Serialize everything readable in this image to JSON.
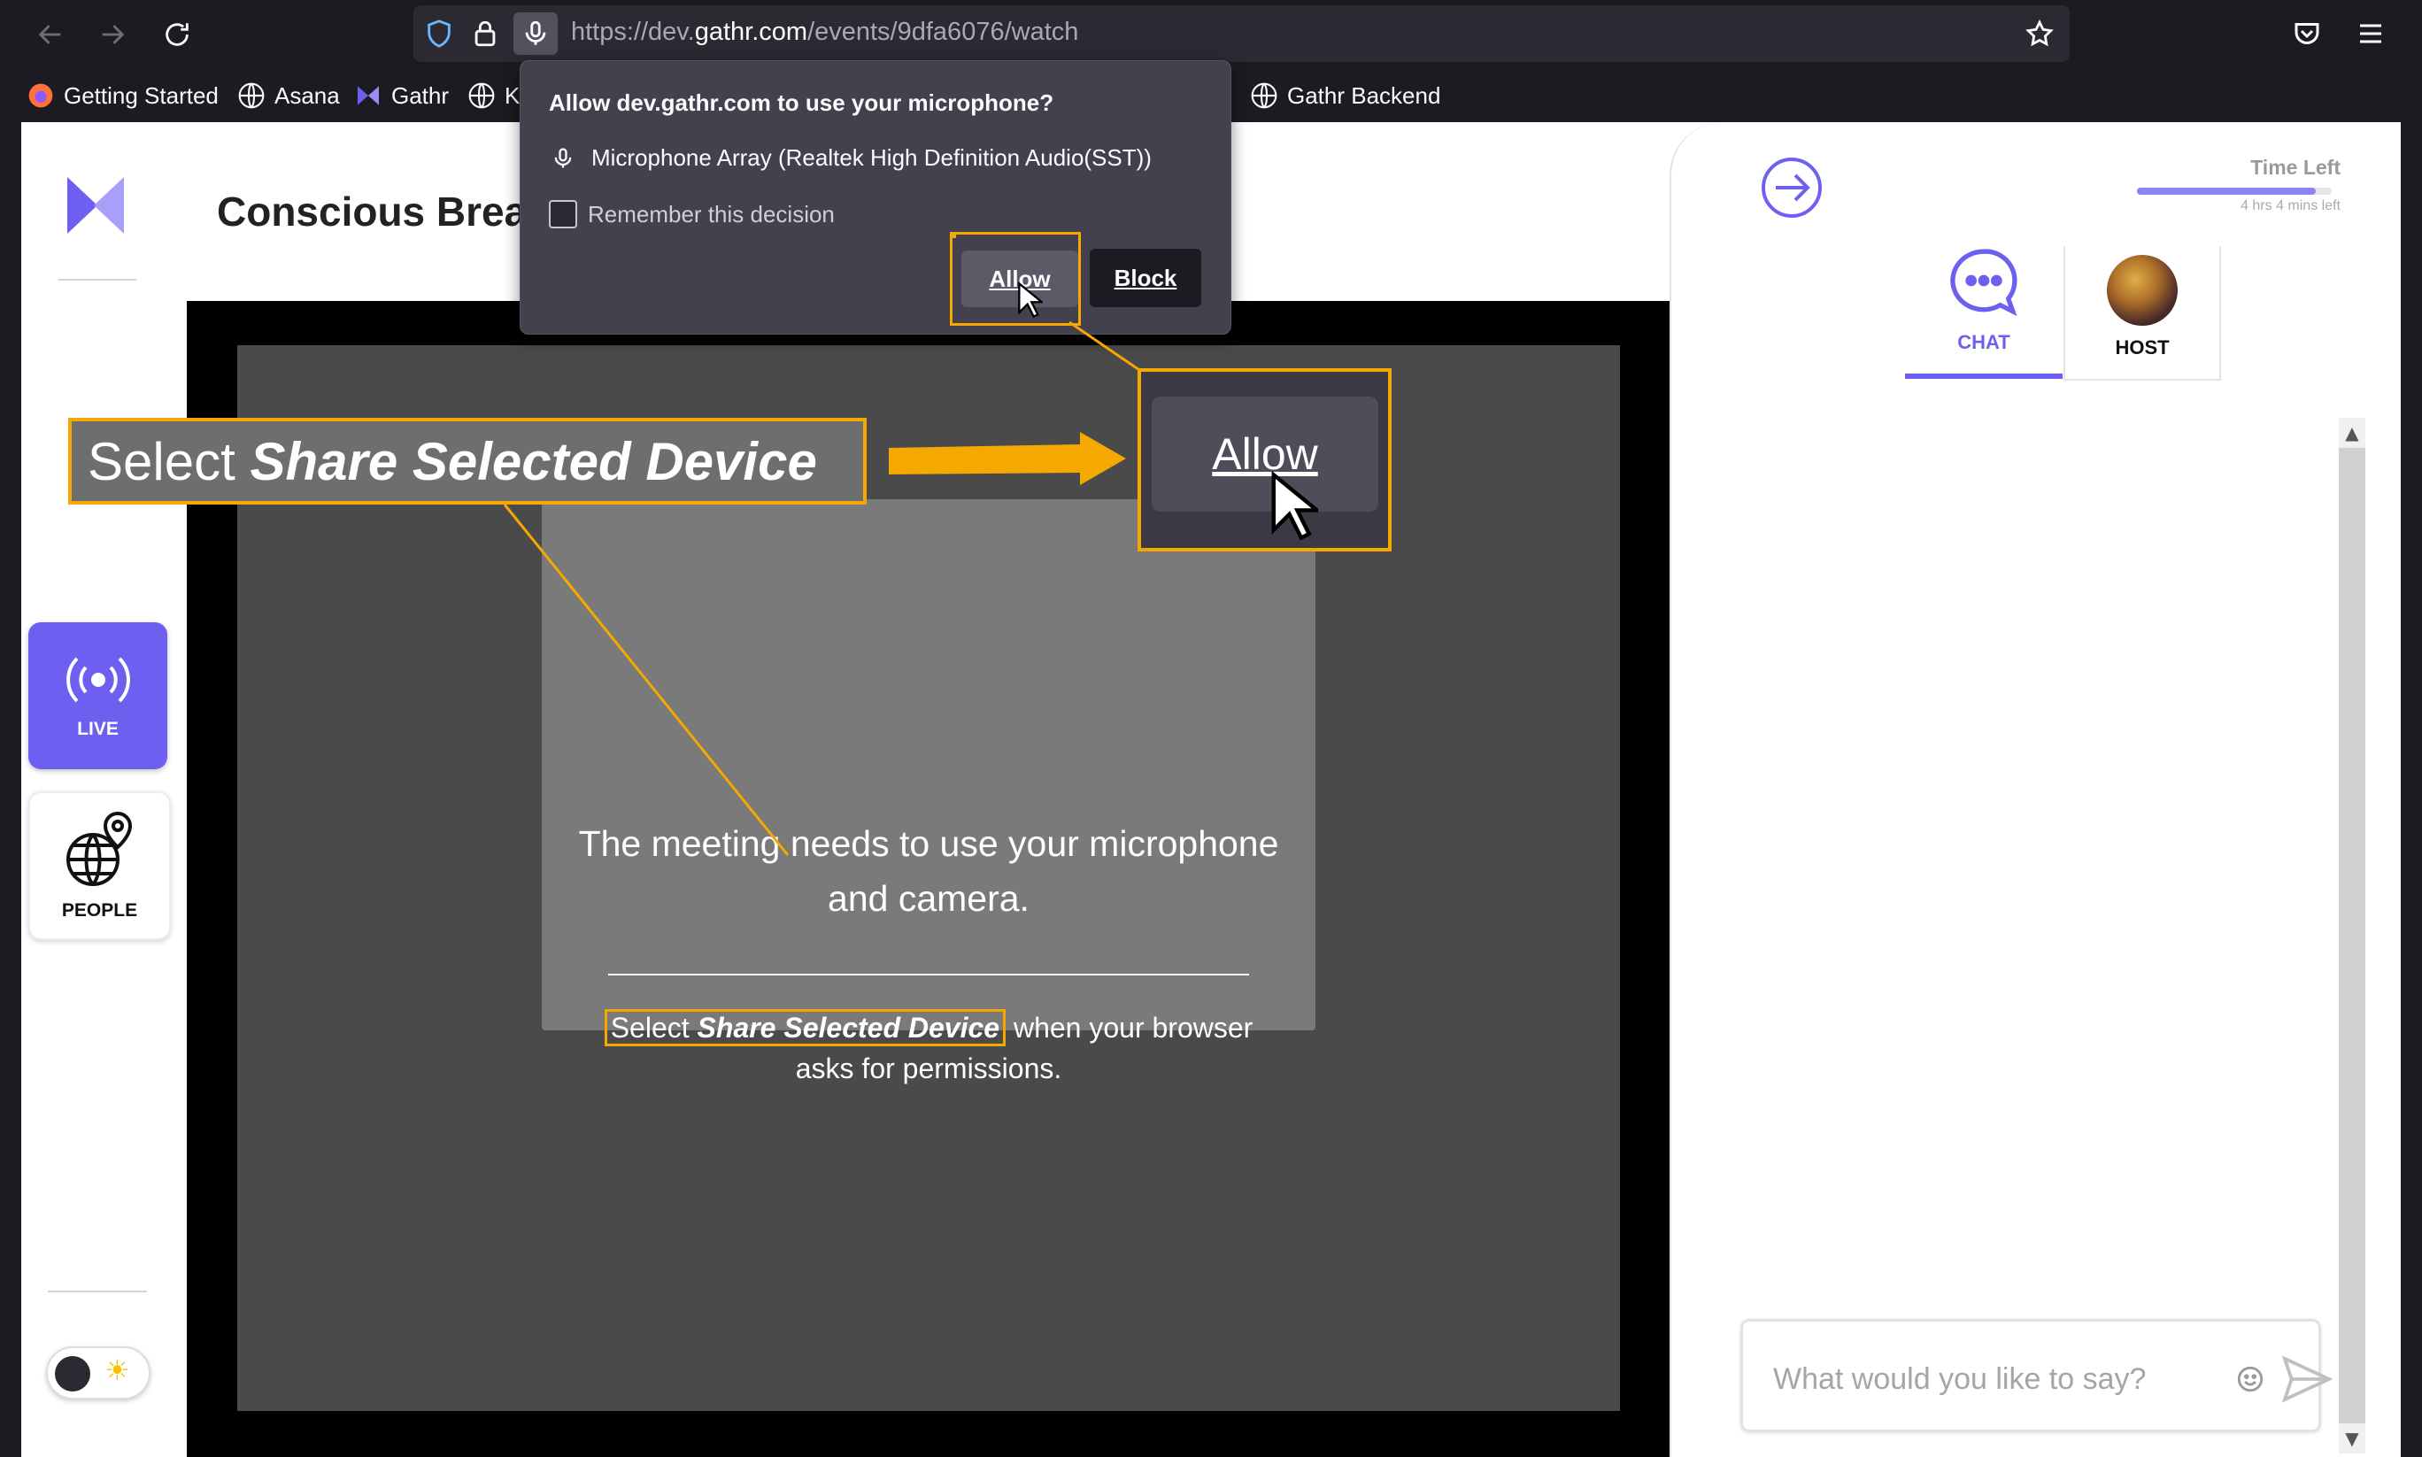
{
  "browser": {
    "url_prefix": "https://dev.",
    "url_domain": "gathr.com",
    "url_path": "/events/9dfa6076/watch",
    "icons": [
      "back-arrow-icon",
      "forward-arrow-icon",
      "reload-icon",
      "shield-icon",
      "lock-icon",
      "microphone-icon",
      "bookmark-star-icon",
      "pocket-icon",
      "menu-icon"
    ]
  },
  "bookmarks": [
    {
      "label": "Getting Started",
      "icon": "firefox-icon"
    },
    {
      "label": "Asana",
      "icon": "globe-icon"
    },
    {
      "label": "Gathr",
      "icon": "gathr-icon"
    },
    {
      "label": "Ki",
      "icon": "globe-icon"
    },
    {
      "label": "Gathr Backend",
      "icon": "globe-icon"
    }
  ],
  "popup": {
    "title": "Allow dev.gathr.com to use your microphone?",
    "device": "Microphone Array (Realtek High Definition Audio(SST))",
    "remember": "Remember this decision",
    "allow": "Allow",
    "block": "Block"
  },
  "app": {
    "title": "Conscious Brea",
    "live_label": "LIVE",
    "people_label": "PEOPLE"
  },
  "stage": {
    "heading": "The meeting needs to use your microphone and camera.",
    "instr_select": "Select",
    "instr_bold": "Share Selected Device",
    "instr_rest": "when your browser asks for permissions."
  },
  "panel": {
    "time_left": "Time Left",
    "time_left_sub": "4 hrs 4 mins left",
    "time_fraction": 0.92,
    "tab_chat": "CHAT",
    "tab_host": "HOST",
    "input_placeholder": "What would you like to say?"
  },
  "callout": {
    "select": "Select",
    "bold": "Share Selected Device",
    "zoom_allow": "Allow"
  },
  "colors": {
    "accent": "#6d5ff0",
    "highlight": "#f5a800",
    "browser_bg": "#1c1b22"
  }
}
